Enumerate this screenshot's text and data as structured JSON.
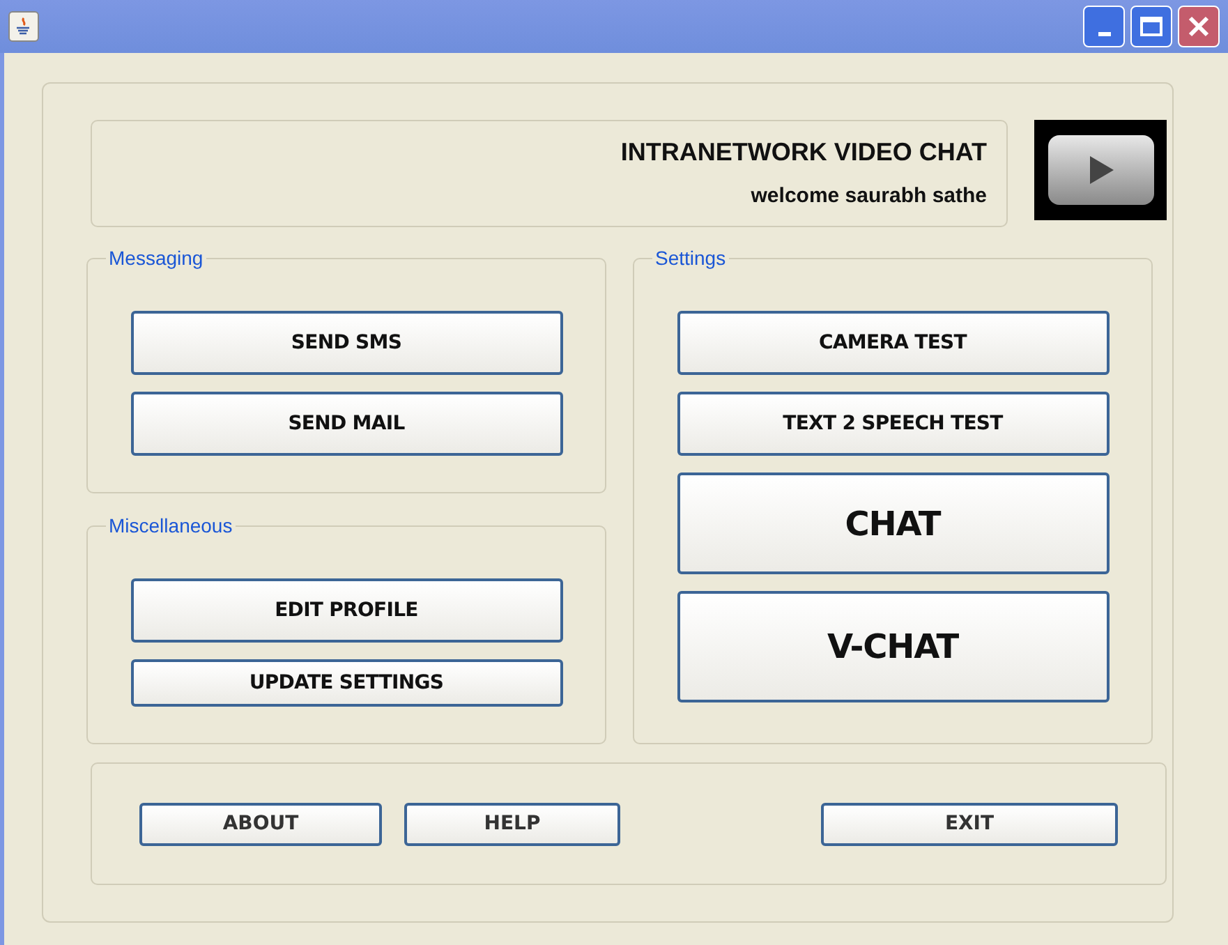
{
  "header": {
    "title": "INTRANETWORK VIDEO CHAT",
    "welcome": "welcome saurabh sathe"
  },
  "groups": [
    {
      "title": "Messaging",
      "buttons": [
        {
          "label": "SEND SMS",
          "kind": "normal"
        },
        {
          "label": "SEND MAIL",
          "kind": "normal"
        }
      ]
    },
    {
      "title": "Miscellaneous",
      "buttons": [
        {
          "label": "EDIT PROFILE",
          "kind": "normal"
        },
        {
          "label": "UPDATE SETTINGS",
          "kind": "small"
        }
      ]
    },
    {
      "title": "Settings",
      "buttons": [
        {
          "label": "CAMERA TEST",
          "kind": "normal"
        },
        {
          "label": "TEXT 2 SPEECH TEST",
          "kind": "normal"
        },
        {
          "label": "CHAT",
          "kind": "large"
        },
        {
          "label": "V-CHAT",
          "kind": "xlarge"
        }
      ]
    }
  ],
  "footer_buttons": [
    {
      "label": "ABOUT"
    },
    {
      "label": "HELP"
    },
    {
      "label": "EXIT"
    }
  ]
}
